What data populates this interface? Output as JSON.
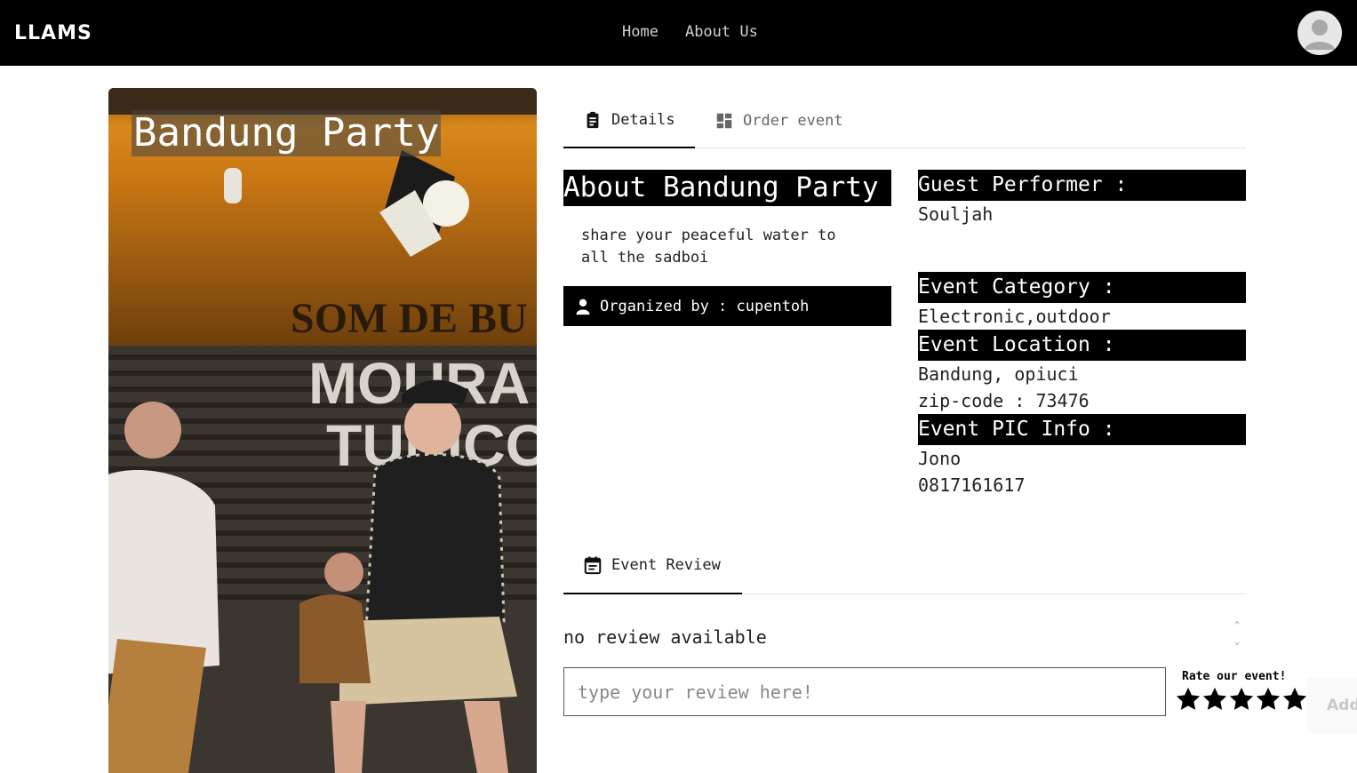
{
  "nav": {
    "logo": "LLAMS",
    "links": [
      "Home",
      "About Us"
    ]
  },
  "event": {
    "title": "Bandung Party",
    "photo_text": [
      "SOM DE BU",
      "MOURA",
      "TUNICO"
    ]
  },
  "tabs": {
    "details": "Details",
    "order": "Order event"
  },
  "about": {
    "heading": "About Bandung Party",
    "description": "share your peaceful water to all the sadboi",
    "organizer": "Organized by : cupentoh"
  },
  "info": {
    "guest_label": "Guest Performer :",
    "guest_value": "Souljah",
    "category_label": "Event Category :",
    "category_value": "Electronic,outdoor",
    "location_label": "Event Location :",
    "location_value": "Bandung, opiuci",
    "zip_value": "zip-code : 73476",
    "pic_label": "Event PIC Info :",
    "pic_name": "Jono",
    "pic_phone": "0817161617"
  },
  "review": {
    "tab_label": "Event Review",
    "empty_text": "no review available",
    "input_placeholder": "type your review here!",
    "rate_label": "Rate our event!",
    "star_count": 5,
    "add_label": "Add"
  },
  "colors": {
    "navbar": "#000000",
    "accent": "#000000",
    "photo_orange": "#d78a1c"
  }
}
